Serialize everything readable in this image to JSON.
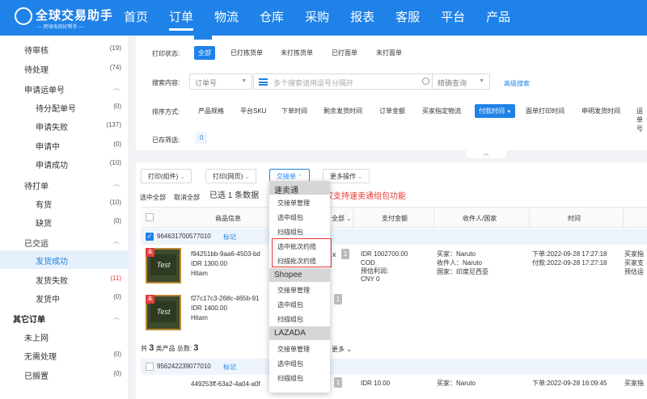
{
  "topbar": {
    "logo": {
      "title": "全球交易助手",
      "subtitle": "— 跨境电商好帮手 —"
    },
    "nav": [
      "首页",
      "订单",
      "物流",
      "仓库",
      "采购",
      "报表",
      "客服",
      "平台",
      "产品"
    ],
    "active_nav": "订单"
  },
  "sidebar": {
    "items": [
      {
        "label": "待审核",
        "count": "(19)"
      },
      {
        "label": "待处理",
        "count": "(74)"
      },
      {
        "label": "申请运单号"
      },
      {
        "label": "待分配单号",
        "count": "(0)"
      },
      {
        "label": "申请失败",
        "count": "(137)"
      },
      {
        "label": "申请中",
        "count": "(0)"
      },
      {
        "label": "申请成功",
        "count": "(10)"
      },
      {
        "label": "待打单"
      },
      {
        "label": "有货",
        "count": "(10)"
      },
      {
        "label": "缺货",
        "count": "(0)"
      },
      {
        "label": "已交运"
      },
      {
        "label": "发货成功"
      },
      {
        "label": "发货失败",
        "count": "(11)"
      },
      {
        "label": "发货中",
        "count": "(0)"
      },
      {
        "label": "其它订单"
      },
      {
        "label": "未上网"
      },
      {
        "label": "无需处理",
        "count": "(0)"
      },
      {
        "label": "已搁置",
        "count": "(0)"
      }
    ]
  },
  "filter": {
    "print_status_label": "打印状态:",
    "print_status": [
      "全部",
      "已打拣货单",
      "未打拣货单",
      "已打面单",
      "未打面单"
    ],
    "search_label": "搜索内容:",
    "search_field": "订单号",
    "search_placeholder": "多个搜索请用逗号分隔开",
    "match_mode": "精确查询",
    "advanced": "高级搜索",
    "sort_label": "排序方式:",
    "sort_options": [
      "产品规格",
      "平台SKU",
      "下单时间",
      "剩余发货时间",
      "订单金额",
      "买家指定物流",
      "付款时间",
      "面单打印时间",
      "申明发货时间",
      "运单号"
    ],
    "active_sort": "付款时间",
    "saved_label": "已存筛选:",
    "saved_count": "0"
  },
  "toolbar": {
    "print_pack": "打印(组件)",
    "print_web": "打印(网页)",
    "handover": "交接单",
    "more": "更多操作",
    "select_all": "选中全部",
    "deselect_all": "取消全部",
    "selected_prefix": "已选 1 条数据",
    "notice": "仅支持速卖通组包功能"
  },
  "table": {
    "headers": [
      "商品信息",
      "全部",
      "支付金额",
      "收件人/国家",
      "时间"
    ],
    "orders": [
      {
        "order_id": "964631700577010",
        "tag": "标记",
        "items": [
          {
            "sku": "f94251bb-9aa6-4503-bd",
            "price": "IDR 1300.00",
            "store": "Hitam",
            "qty": "1",
            "thumb": "Test"
          },
          {
            "sku": "f27c17c3-268c-465b-91",
            "price": "IDR 1400.00",
            "store": "Hitam",
            "qty": "1",
            "thumb": "Test"
          }
        ],
        "x": "x",
        "amount": [
          "IDR 1002700.00",
          "COD",
          "预估利润:",
          "CNY 0"
        ],
        "recipient": [
          "买家：Naruto",
          "收件人：Naruto",
          "国家：印度尼西亚"
        ],
        "times": [
          "下单:2022-09-28 17:27:18",
          "付款:2022-09-28 17:27:18"
        ],
        "extra": [
          "买家指",
          "买家支",
          "预估运"
        ],
        "summary_prefix": "共",
        "summary_kinds": "3",
        "summary_mid": "类产品 总数:",
        "summary_total": "3",
        "summary_more": "更多"
      },
      {
        "order_id": "956242239077010",
        "tag": "标记",
        "items": [
          {
            "sku": "449253ff-63a2-4a04-a0f",
            "qty": "1"
          }
        ],
        "amount": [
          "IDR 10.00"
        ],
        "recipient": [
          "买家：Naruto"
        ],
        "times": [
          "下单:2022-09-28 16:09:45"
        ],
        "extra": [
          "买家指"
        ]
      }
    ]
  },
  "dropdown": {
    "groups": [
      {
        "name": "速卖通",
        "items": [
          "交接单管理",
          "选中组包",
          "扫描组包",
          "选中批次约揽",
          "扫描批次约揽"
        ]
      },
      {
        "name": "Shopee",
        "items": [
          "交接单管理",
          "选中组包",
          "扫描组包"
        ]
      },
      {
        "name": "LAZADA",
        "items": [
          "交接单管理",
          "选中组包",
          "扫描组包"
        ]
      }
    ]
  },
  "colors": {
    "brand": "#1f82e8",
    "alert": "#e53935"
  }
}
